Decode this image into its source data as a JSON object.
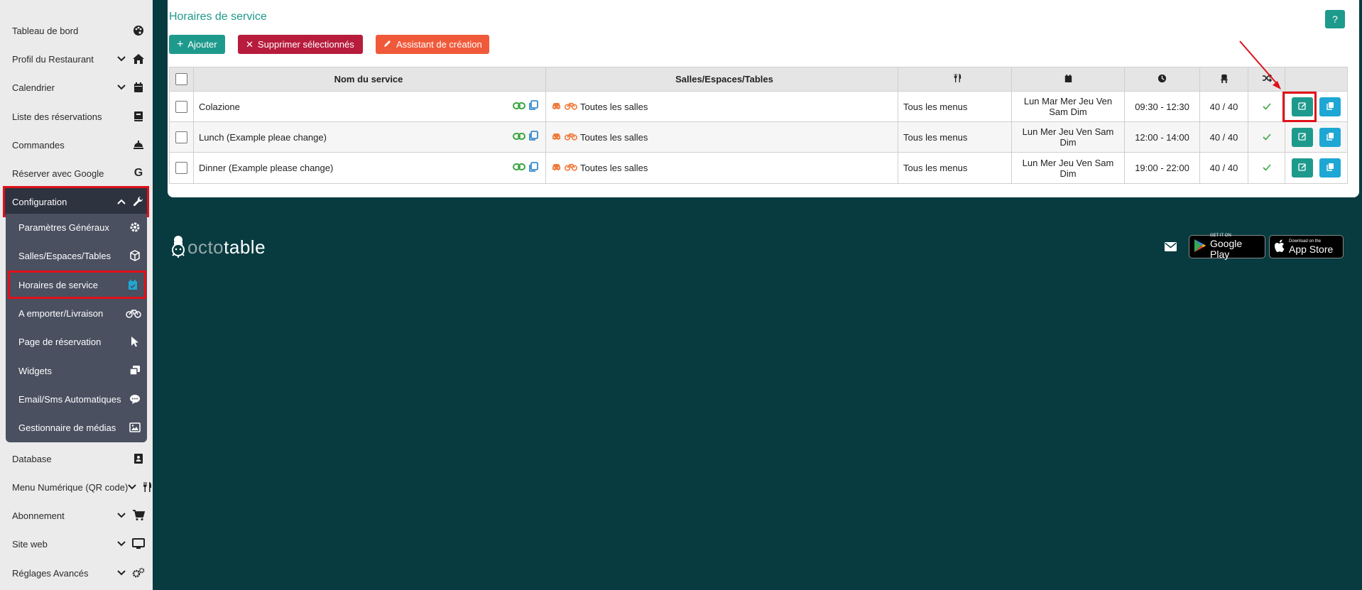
{
  "sidebar": {
    "items": [
      {
        "label": "Tableau de bord",
        "icon": "palette-icon"
      },
      {
        "label": "Profil du Restaurant",
        "icon": "home-icon",
        "chevron": true
      },
      {
        "label": "Calendrier",
        "icon": "calendar-icon",
        "chevron": true
      },
      {
        "label": "Liste des réservations",
        "icon": "book-icon"
      },
      {
        "label": "Commandes",
        "icon": "cloche-icon"
      },
      {
        "label": "Réserver avec Google",
        "icon": "google-icon"
      },
      {
        "label": "Configuration",
        "icon": "wrench-icon",
        "chevron": true
      },
      {
        "label": "Database",
        "icon": "address-book-icon"
      },
      {
        "label": "Menu Numérique (QR code)",
        "icon": "utensils-icon",
        "chevron": true
      },
      {
        "label": "Abonnement",
        "icon": "cart-icon",
        "chevron": true
      },
      {
        "label": "Site web",
        "icon": "monitor-icon",
        "chevron": true
      },
      {
        "label": "Réglages Avancés",
        "icon": "cogs-icon",
        "chevron": true
      }
    ],
    "submenu": [
      {
        "label": "Paramètres Généraux",
        "icon": "gear-icon"
      },
      {
        "label": "Salles/Espaces/Tables",
        "icon": "cube-icon"
      },
      {
        "label": "Horaires de service",
        "icon": "calendar-check-icon"
      },
      {
        "label": "A emporter/Livraison",
        "icon": "bicycle-icon"
      },
      {
        "label": "Page de réservation",
        "icon": "pointer-icon"
      },
      {
        "label": "Widgets",
        "icon": "window-restore-icon"
      },
      {
        "label": "Email/Sms Automatiques",
        "icon": "comment-icon"
      },
      {
        "label": "Gestionnaire de médias",
        "icon": "image-icon"
      }
    ]
  },
  "page": {
    "title": "Horaires de service",
    "help_label": "?"
  },
  "toolbar": {
    "add_label": "Ajouter",
    "delete_label": "Supprimer sélectionnés",
    "wizard_label": "Assistant de création"
  },
  "table": {
    "headers": {
      "name": "Nom du service",
      "rooms": "Salles/Espaces/Tables"
    },
    "rows": [
      {
        "name": "Colazione",
        "rooms": "Toutes les salles",
        "menus": "Tous les menus",
        "days": "Lun Mar Mer Jeu Ven Sam Dim",
        "hours": "09:30 - 12:30",
        "capacity": "40 / 40"
      },
      {
        "name": "Lunch (Example pleae change)",
        "rooms": "Toutes les salles",
        "menus": "Tous les menus",
        "days": "Lun Mer Jeu Ven Sam Dim",
        "hours": "12:00 - 14:00",
        "capacity": "40 / 40"
      },
      {
        "name": "Dinner (Example please change)",
        "rooms": "Toutes les salles",
        "menus": "Tous les menus",
        "days": "Lun Mer Jeu Ven Sam Dim",
        "hours": "19:00 - 22:00",
        "capacity": "40 / 40"
      }
    ]
  },
  "footer": {
    "logo_octo": "octo",
    "logo_table": "table",
    "google_small": "GET IT ON",
    "google_big": "Google Play",
    "apple_small": "Download on the",
    "apple_big": "App Store"
  },
  "colors": {
    "accent": "#1e9a8c",
    "danger": "#b71c3c",
    "warning": "#f05a3a",
    "footer_bg": "#073b40",
    "highlight": "#e0101a"
  }
}
